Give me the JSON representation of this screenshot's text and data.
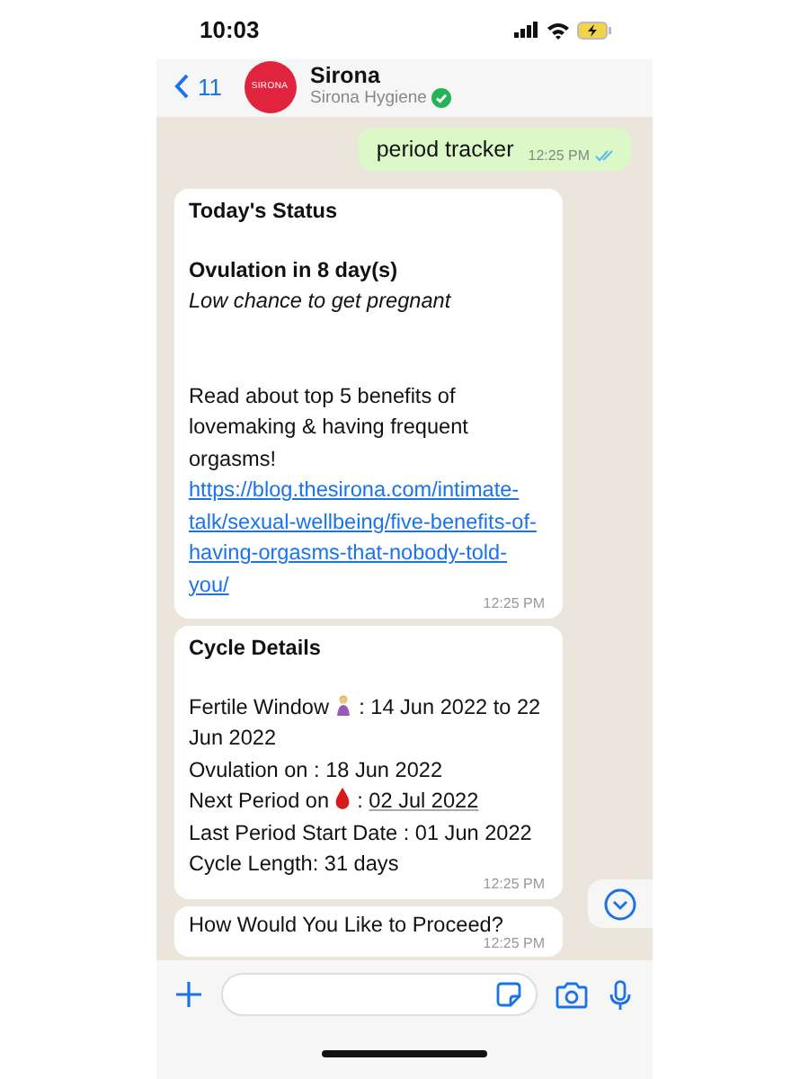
{
  "status_bar": {
    "time": "10:03"
  },
  "header": {
    "back_count": "11",
    "avatar_text": "SIRONA",
    "name": "Sirona",
    "subtitle": "Sirona Hygiene",
    "verified": true
  },
  "messages": [
    {
      "kind": "outgoing",
      "text": "period tracker",
      "time": "12:25 PM",
      "read": true
    },
    {
      "kind": "status",
      "time": "12:25 PM",
      "blocks": [
        {
          "kind": "heading",
          "text": "Today's Status"
        },
        {
          "kind": "bold",
          "text": "Ovulation in 8 day(s)"
        },
        {
          "kind": "italic",
          "text": "Low chance to get pregnant"
        },
        {
          "kind": "paragraph",
          "text": "Read about top 5 benefits of lovemaking & having frequent orgasms!"
        },
        {
          "kind": "link",
          "text": "https://blog.thesirona.com/intimate-talk/sexual-wellbeing/five-benefits-of-having-orgasms-that-nobody-told-you/"
        }
      ]
    },
    {
      "kind": "details",
      "time": "12:25 PM",
      "title": "Cycle Details",
      "lines": [
        {
          "kind": "fertile_window",
          "text": "Fertile Window",
          "after": ":  14 Jun 2022 to 22 Jun 2022"
        },
        {
          "kind": "plain",
          "text": "Ovulation on : 18 Jun 2022"
        },
        {
          "kind": "next_period",
          "text": "Next Period on",
          "after": ":",
          "date": "02 Jul 2022"
        },
        {
          "kind": "plain",
          "text": "Last Period Start Date : 01 Jun 2022"
        },
        {
          "kind": "plain",
          "text": "Cycle Length: 31 days"
        }
      ]
    },
    {
      "kind": "incoming",
      "text": "How Would You Like to Proceed?",
      "time": "12:25 PM"
    }
  ]
}
